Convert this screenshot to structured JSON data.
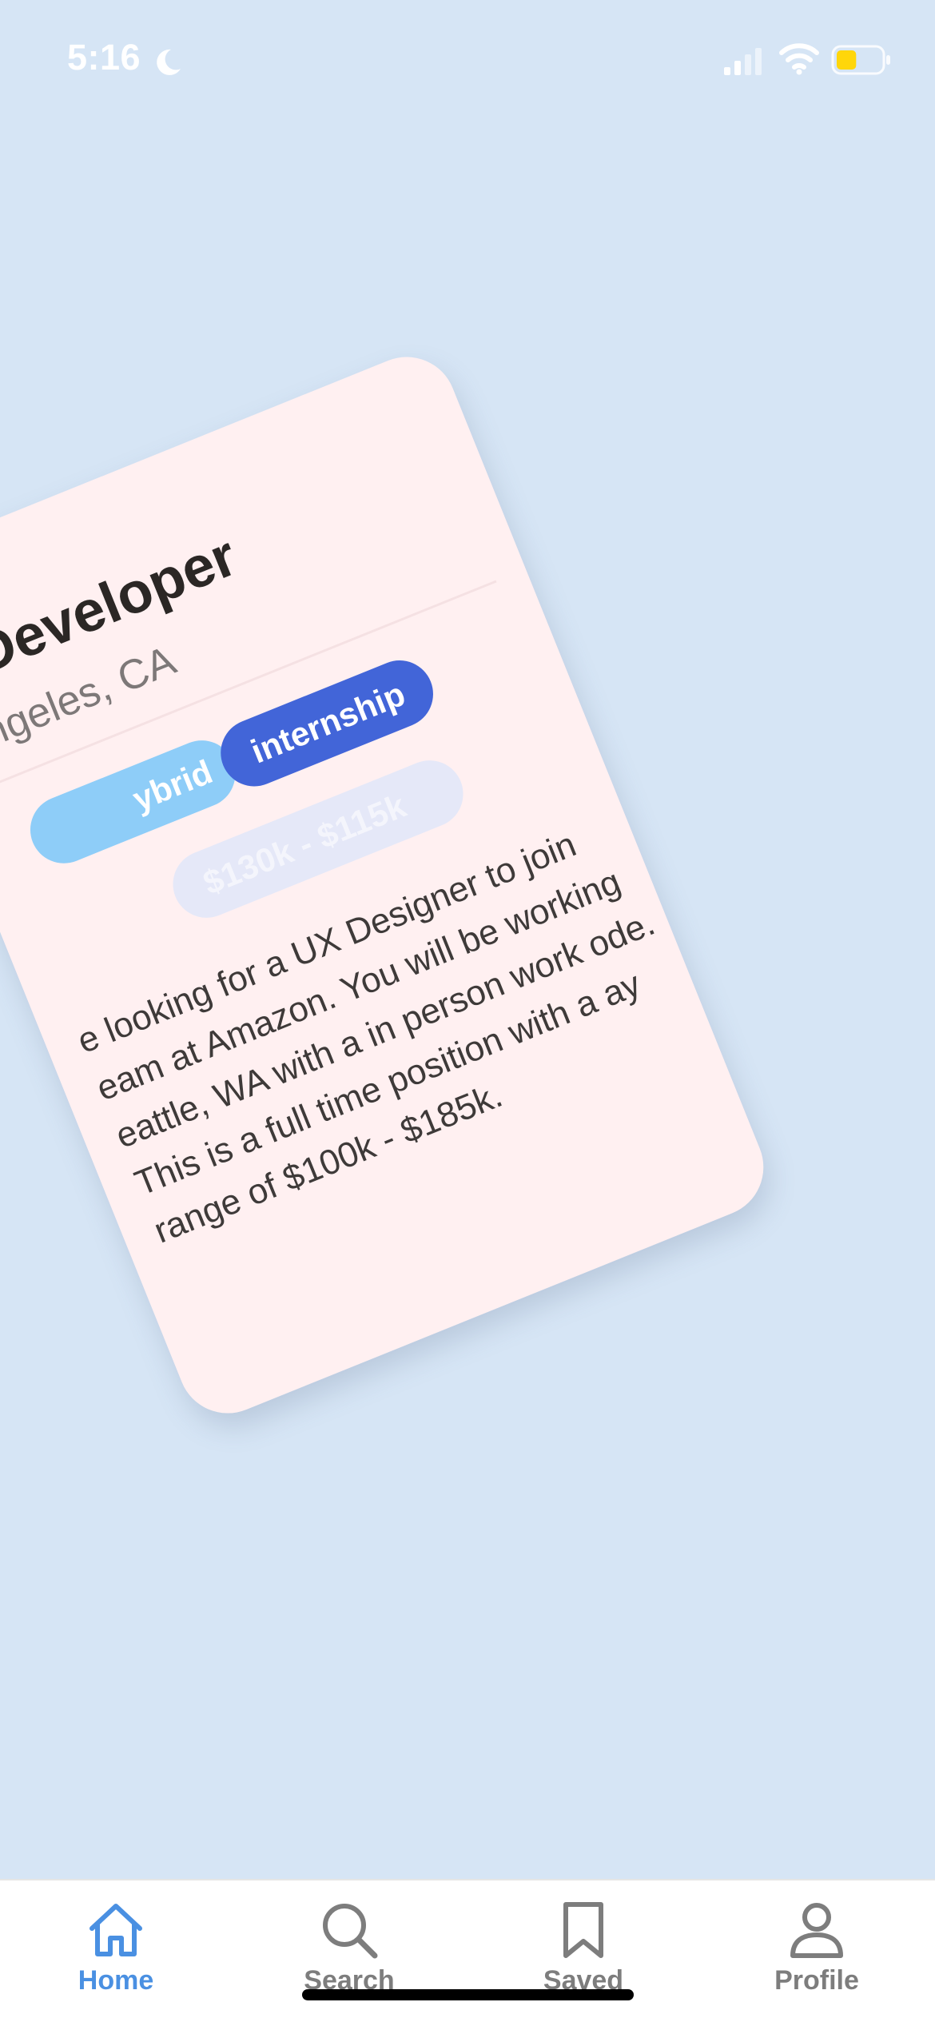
{
  "status_bar": {
    "time": "5:16",
    "icons": [
      "moon-icon",
      "cellular-signal-icon",
      "wifi-icon",
      "battery-icon"
    ],
    "battery_color": "#ffd60a",
    "battery_level": 0.45
  },
  "job_card": {
    "title": "x Developer",
    "location": "Angeles, CA",
    "tags": {
      "work_mode": "ybrid",
      "job_type": "internship",
      "salary": "$130k - $115k"
    },
    "description": "e looking for a UX Designer to join eam at Amazon. You will be working eattle, WA with a in person work ode. This is a full time position with a ay range of $100k - $185k.",
    "colors": {
      "card_background": "#fff0f1",
      "work_mode_tag": "#8ecdf8",
      "job_type_tag": "#4265d8",
      "salary_tag": "#e5e8f8"
    }
  },
  "tab_bar": {
    "items": [
      {
        "label": "Home",
        "icon": "house-icon",
        "active": true
      },
      {
        "label": "Search",
        "icon": "magnifier-icon",
        "active": false
      },
      {
        "label": "Saved",
        "icon": "bookmark-icon",
        "active": false
      },
      {
        "label": "Profile",
        "icon": "person-icon",
        "active": false
      }
    ],
    "active_color": "#4a90e2",
    "inactive_color": "#7d7d7d"
  },
  "colors": {
    "background": "#d6e5f5"
  }
}
